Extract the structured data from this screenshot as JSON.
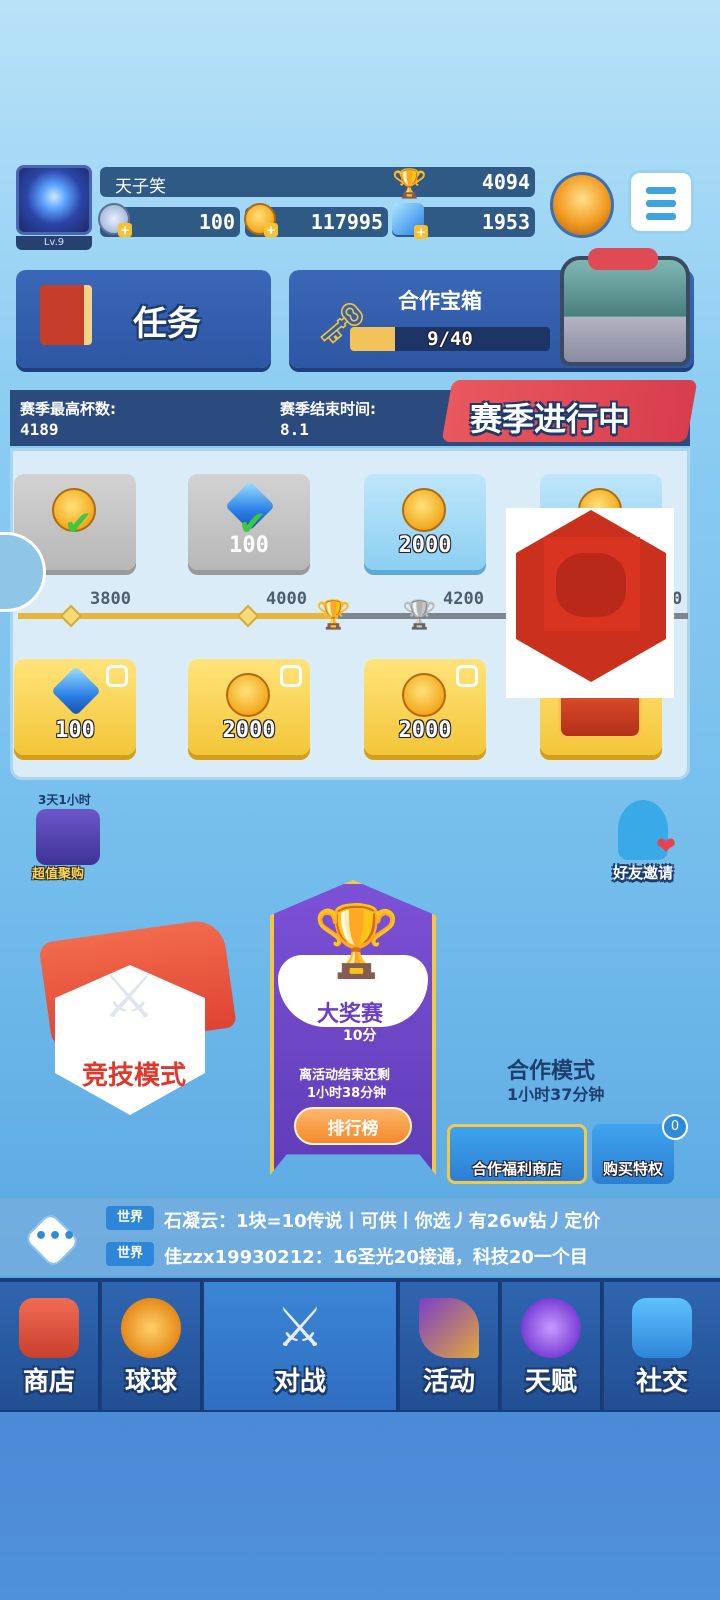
{
  "player": {
    "name": "天子笑",
    "level": "Lv.9",
    "trophies": "4094",
    "stamina": "100",
    "coins": "117995",
    "gems": "1953"
  },
  "task": {
    "label": "任务"
  },
  "coop_chest": {
    "title": "合作宝箱",
    "progress": "9/40",
    "fill": 0.225
  },
  "season": {
    "max_cups_label": "赛季最高杯数:",
    "max_cups_value": "4189",
    "end_label": "赛季结束时间:",
    "end_value": "8.1",
    "status": "赛季进行中"
  },
  "track": {
    "milestones": [
      "3800",
      "4000",
      "4200",
      "0"
    ],
    "top_rewards": [
      {
        "value": "",
        "claimed": true,
        "style": "grey",
        "icon": "coin-question-icon"
      },
      {
        "value": "100",
        "claimed": true,
        "style": "grey",
        "icon": "gem-icon"
      },
      {
        "value": "2000",
        "claimed": false,
        "style": "blue",
        "icon": "coin-icon"
      },
      {
        "value": "",
        "claimed": false,
        "style": "blue",
        "icon": "coin-question-icon"
      }
    ],
    "bottom_rewards": [
      {
        "value": "100",
        "locked": true,
        "icon": "gem-icon"
      },
      {
        "value": "2000",
        "locked": true,
        "icon": "coin-icon"
      },
      {
        "value": "2000",
        "locked": true,
        "icon": "coin-icon"
      },
      {
        "value": "",
        "locked": true,
        "icon": "treasure-chest-icon"
      }
    ]
  },
  "deal": {
    "timer": "3天1小时",
    "label": "超值聚购"
  },
  "invite": {
    "label": "好友邀请"
  },
  "compete": {
    "label": "竞技模式"
  },
  "grand_prix": {
    "title": "大奖赛",
    "score": "10分",
    "ends_line": "离活动结束还剩",
    "timer": "1小时38分钟",
    "rank_button": "排行榜"
  },
  "coop_mode": {
    "title": "合作模式",
    "timer": "1小时37分钟",
    "shop_button": "合作福利商店",
    "buy_button": "购买特权",
    "badge": "0"
  },
  "chat": {
    "messages": [
      {
        "tag": "世界",
        "text": "石凝云：1块=10传说丨可供丨你选丿有26w钻丿定价"
      },
      {
        "tag": "世界",
        "text": "佳zzx19930212：16圣光20接通，科技20一个目"
      }
    ]
  },
  "nav": [
    {
      "label": "商店",
      "icon": "shop-icon"
    },
    {
      "label": "球球",
      "icon": "balls-icon"
    },
    {
      "label": "对战",
      "icon": "crossed-swords-icon",
      "active": true
    },
    {
      "label": "活动",
      "icon": "party-popper-icon"
    },
    {
      "label": "天赋",
      "icon": "planet-icon"
    },
    {
      "label": "社交",
      "icon": "chat-heart-icon"
    }
  ],
  "colors": {
    "accent": "#2f6ec1",
    "gold": "#f3c638",
    "red_marker": "#c9301e"
  }
}
